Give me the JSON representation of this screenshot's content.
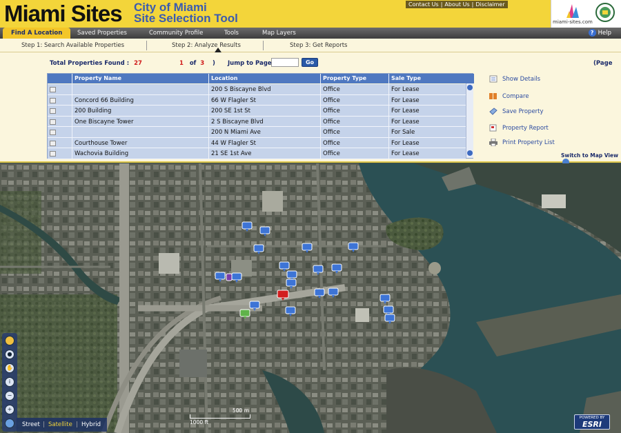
{
  "header": {
    "logo_title": "Miami Sites",
    "subtitle_line1": "City of Miami",
    "subtitle_line2": "Site Selection Tool",
    "top_links": [
      "Contact Us",
      "About Us",
      "Disclaimer"
    ],
    "brand_site": "miami-sites.com"
  },
  "nav": {
    "tabs": [
      "Find A Location",
      "Saved Properties",
      "Community Profile",
      "Tools",
      "Map Layers"
    ],
    "active_tab": "Find A Location",
    "help_label": "Help"
  },
  "steps": [
    "Step 1: Search Available Properties",
    "Step 2: Analyze Results",
    "Step 3: Get Reports"
  ],
  "results": {
    "total_label": "Total Properties Found :",
    "total_count": "27",
    "current_page": "1",
    "of_label": "of",
    "total_pages": "3",
    "close_paren": ")",
    "jump_label": "Jump to Page",
    "jump_value": "",
    "go_label": "Go",
    "page_label": "(Page"
  },
  "table": {
    "columns": [
      "Property Name",
      "Location",
      "Property Type",
      "Sale Type"
    ],
    "rows": [
      {
        "name": "",
        "location": "200 S Biscayne Blvd",
        "type": "Office",
        "sale": "For Lease"
      },
      {
        "name": "Concord 66 Building",
        "location": "66 W Flagler St",
        "type": "Office",
        "sale": "For Lease"
      },
      {
        "name": "200 Building",
        "location": "200 SE 1st St",
        "type": "Office",
        "sale": "For Lease"
      },
      {
        "name": "One Biscayne Tower",
        "location": "2 S Biscayne Blvd",
        "type": "Office",
        "sale": "For Lease"
      },
      {
        "name": "",
        "location": "200 N Miami Ave",
        "type": "Office",
        "sale": "For Sale"
      },
      {
        "name": "Courthouse Tower",
        "location": "44 W Flagler St",
        "type": "Office",
        "sale": "For Lease"
      },
      {
        "name": "Wachovia Building",
        "location": "21 SE 1st Ave",
        "type": "Office",
        "sale": "For Lease"
      }
    ]
  },
  "actions": [
    "Show Details",
    "Compare",
    "Save Property",
    "Property Report",
    "Print Property List"
  ],
  "switch_view_label": "Switch to Map View",
  "map": {
    "map_types": [
      "Street",
      "Satellite",
      "Hybrid"
    ],
    "selected_map_type": "Satellite",
    "scale_metric": "500 m",
    "scale_imperial": "1000 ft",
    "esri_powered": "POWERED BY",
    "esri_name": "ESRI"
  },
  "colors": {
    "header_yellow": "#f3d53a",
    "accent_blue": "#4f78c0",
    "marker_blue": "#3d74d6",
    "marker_red": "#d21f1f",
    "marker_green": "#5fb34a",
    "marker_purple": "#7a3da8"
  },
  "icons": {
    "show_details": "list-icon",
    "compare": "compare-icon",
    "save_property": "save-icon",
    "property_report": "report-icon",
    "print": "printer-icon"
  }
}
